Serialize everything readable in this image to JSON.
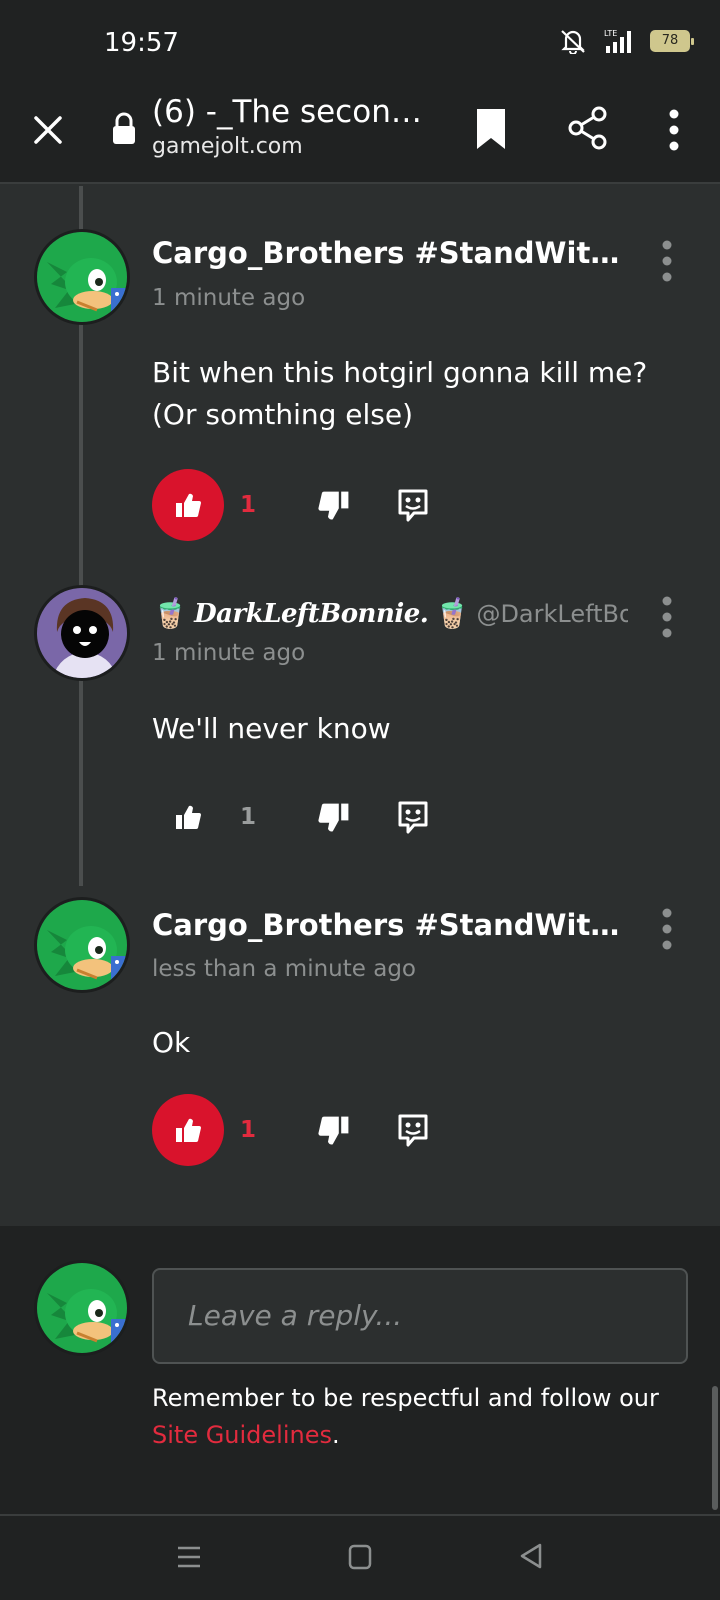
{
  "status_bar": {
    "time": "19:57",
    "battery": "78",
    "icons": [
      "bell-off-icon",
      "lte-signal-icon",
      "battery-icon"
    ]
  },
  "toolbar": {
    "title": "(6) -_The second ...",
    "url": "gamejolt.com",
    "icons": [
      "close-icon",
      "lock-icon",
      "bookmark-icon",
      "share-icon",
      "more-vert-icon"
    ]
  },
  "comments": [
    {
      "author": "Cargo_Brothers #StandWithUkr...",
      "time": "1 minute ago",
      "body": "Bit when this hotgirl gonna kill me? (Or somthing else)",
      "likes": "1",
      "liked": true
    },
    {
      "author_display": "DarkLeftBonnie.",
      "author_handle": "@DarkLeftBo...",
      "author_emoji": "🧋",
      "time": "1 minute ago",
      "body": "We'll never know",
      "likes": "1",
      "liked": false
    },
    {
      "author": "Cargo_Brothers #StandWithUkr...",
      "time": "less than a minute ago",
      "body": "Ok",
      "likes": "1",
      "liked": true
    }
  ],
  "reply_box": {
    "placeholder": "Leave a reply...",
    "note": "Remember to be respectful and follow our ",
    "link": "Site Guidelines",
    "note_end": "."
  },
  "colors": {
    "accent": "#d9132c",
    "background": "#2c2f2f",
    "bar": "#202222"
  }
}
